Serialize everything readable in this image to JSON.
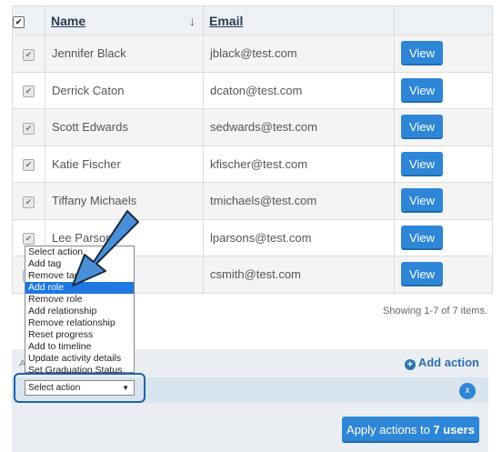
{
  "table": {
    "headers": {
      "name": "Name",
      "email": "Email",
      "sort_icon": "↓"
    },
    "rows": [
      {
        "name": "Jennifer Black",
        "email": "jblack@test.com",
        "view": "View"
      },
      {
        "name": "Derrick Caton",
        "email": "dcaton@test.com",
        "view": "View"
      },
      {
        "name": "Scott Edwards",
        "email": "sedwards@test.com",
        "view": "View"
      },
      {
        "name": "Katie Fischer",
        "email": "kfischer@test.com",
        "view": "View"
      },
      {
        "name": "Tiffany Michaels",
        "email": "tmichaels@test.com",
        "view": "View"
      },
      {
        "name": "Lee Parsons",
        "email": "lparsons@test.com",
        "view": "View"
      },
      {
        "name": "",
        "email": "csmith@test.com",
        "view": "View"
      }
    ]
  },
  "pagination": {
    "showing": "Showing 1-7 of 7 items."
  },
  "actions_panel": {
    "add_action": "Add action",
    "apply_button_prefix": "Apply actions to ",
    "apply_button_count": "7 users",
    "select_value": "Select action",
    "remove_icon": "x"
  },
  "dropdown": {
    "options": [
      "Select action",
      "Add tag",
      "Remove tag",
      "Add role",
      "Remove role",
      "Add relationship",
      "Remove relationship",
      "Reset progress",
      "Add to timeline",
      "Update activity details",
      "Set Graduation Status"
    ],
    "highlighted_index": 3
  },
  "colors": {
    "primary": "#2e86d6",
    "annotation": "#1f64a8",
    "arrow_fill": "#4a90d9"
  }
}
